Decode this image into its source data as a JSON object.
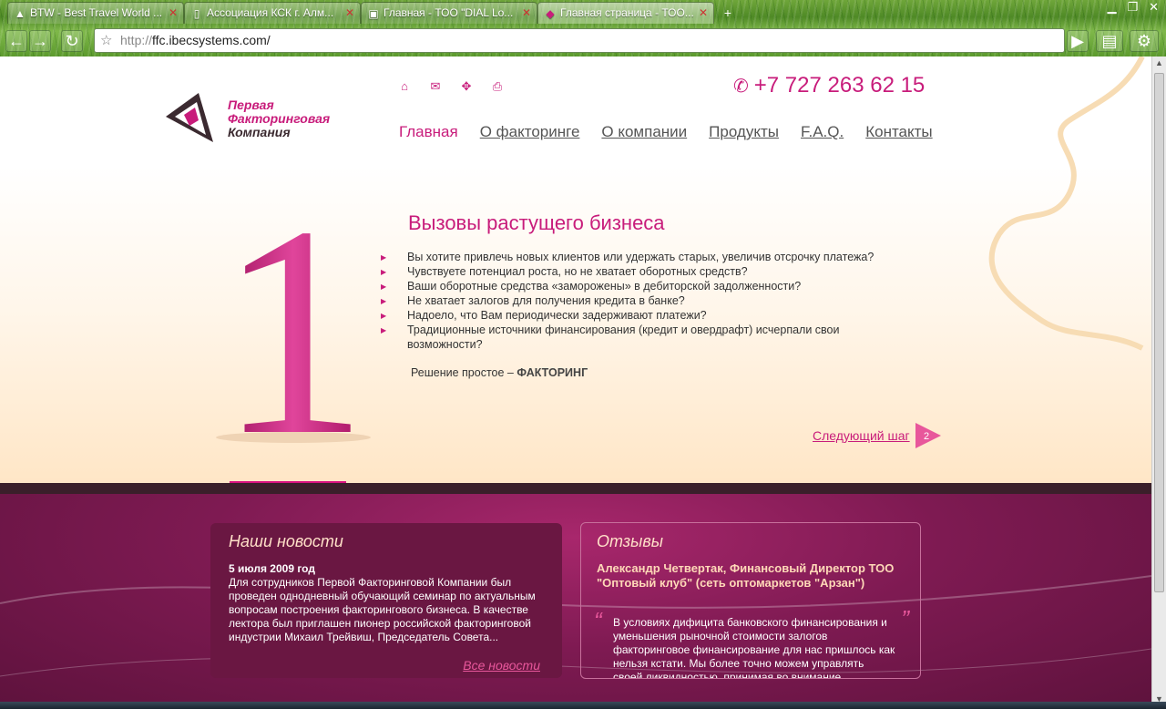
{
  "browser": {
    "tabs": [
      {
        "label": "BTW - Best Travel World ...",
        "icon": "triangle-icon",
        "active": false
      },
      {
        "label": "Ассоциация КСК г. Алм...",
        "icon": "page-icon",
        "active": false
      },
      {
        "label": "Главная - ТОО \"DIAL Lo...",
        "icon": "dial-icon",
        "active": false
      },
      {
        "label": "Главная страница - ТОО...",
        "icon": "ffc-icon",
        "active": true
      }
    ],
    "url_protocol": "http://",
    "url_host": "ffc.ibecsystems.com/"
  },
  "site": {
    "logo": {
      "line1": "Первая",
      "line2": "Факторинговая",
      "line3": "Компания"
    },
    "top_icons": [
      "home-icon",
      "mail-icon",
      "sitemap-icon",
      "print-icon"
    ],
    "phone": "+7 727 263 62 15",
    "menu": [
      {
        "label": "Главная",
        "active": true
      },
      {
        "label": "О факторинге",
        "active": false
      },
      {
        "label": "О компании",
        "active": false
      },
      {
        "label": "Продукты",
        "active": false
      },
      {
        "label": "F.A.Q.",
        "active": false
      },
      {
        "label": "Контакты",
        "active": false
      }
    ],
    "hero": {
      "step_number": "1",
      "title": "Вызовы растущего бизнеса",
      "bullets": [
        "Вы хотите привлечь новых клиентов или удержать старых, увеличив отсрочку платежа?",
        "Чувствуете потенциал роста, но не хватает оборотных средств?",
        "Ваши оборотные средства «заморожены» в дебиторской задолженности?",
        "Не хватает залогов для получения кредита в банке?",
        "Надоело, что Вам периодически задерживают платежи?",
        "Традиционные источники финансирования (кредит и овердрафт) исчерпали свои возможности?"
      ],
      "solution_prefix": "Решение простое – ",
      "solution_bold": "ФАКТОРИНГ",
      "next_step_label": "Следующий шаг",
      "next_step_number": "2"
    },
    "news": {
      "title": "Наши новости",
      "date": "5 июля 2009 год",
      "text": "Для сотрудников Первой Факторинговой Компании был проведен однодневный обучающий семинар по актуальным вопросам построения факторингового бизнеса. В качестве лектора был приглашен пионер российской факторинговой индустрии Михаил Трейвиш, Председатель Совета...",
      "all_link": "Все новости"
    },
    "reviews": {
      "title": "Отзывы",
      "author": "Александр Четвертак, Финансовый Директор ТОО \"Оптовый клуб\" (сеть оптомаркетов \"Арзан\")",
      "text": "В условиях дифицита банковского финансирования и уменьшения рыночной стоимости залогов факторинговое финансирование для нас пришлось как нельзя кстати. Мы более точно можем управлять своей ликвидностью, принимая во внимание непростые реалии кризиса, а также сохранять и"
    }
  },
  "colors": {
    "brand_pink": "#c81c7b",
    "dark_plum": "#6a1742",
    "peach": "#ffe6c6"
  }
}
